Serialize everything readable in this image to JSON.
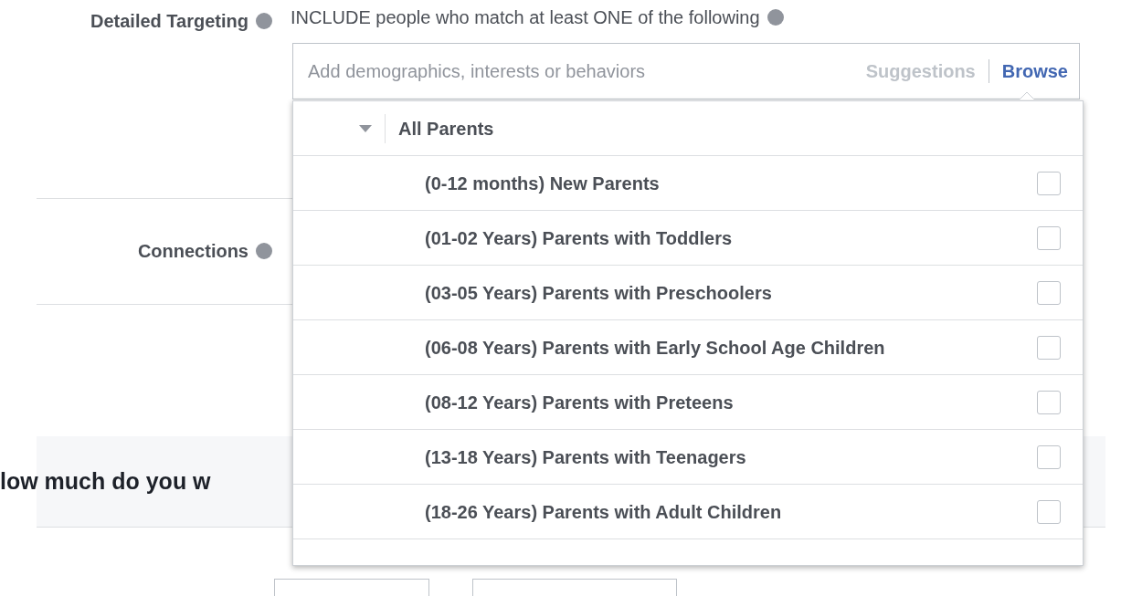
{
  "detailed_targeting": {
    "label": "Detailed Targeting",
    "include_text": "INCLUDE people who match at least ONE of the following",
    "search": {
      "placeholder": "Add demographics, interests or behaviors"
    },
    "links": [
      {
        "label": "Suggestions",
        "selected": false
      },
      {
        "label": "Browse",
        "selected": true
      }
    ]
  },
  "dropdown": {
    "category": {
      "label": "All Parents",
      "expanded": true
    },
    "items": [
      {
        "label": "(0-12 months) New Parents",
        "checked": false
      },
      {
        "label": "(01-02 Years) Parents with Toddlers",
        "checked": false
      },
      {
        "label": "(03-05 Years) Parents with Preschoolers",
        "checked": false
      },
      {
        "label": "(06-08 Years) Parents with Early School Age Children",
        "checked": false
      },
      {
        "label": "(08-12 Years) Parents with Preteens",
        "checked": false
      },
      {
        "label": "(13-18 Years) Parents with Teenagers",
        "checked": false
      },
      {
        "label": "(18-26 Years) Parents with Adult Children",
        "checked": false
      }
    ]
  },
  "connections": {
    "label": "Connections"
  },
  "budget_heading": "low much do you w"
}
